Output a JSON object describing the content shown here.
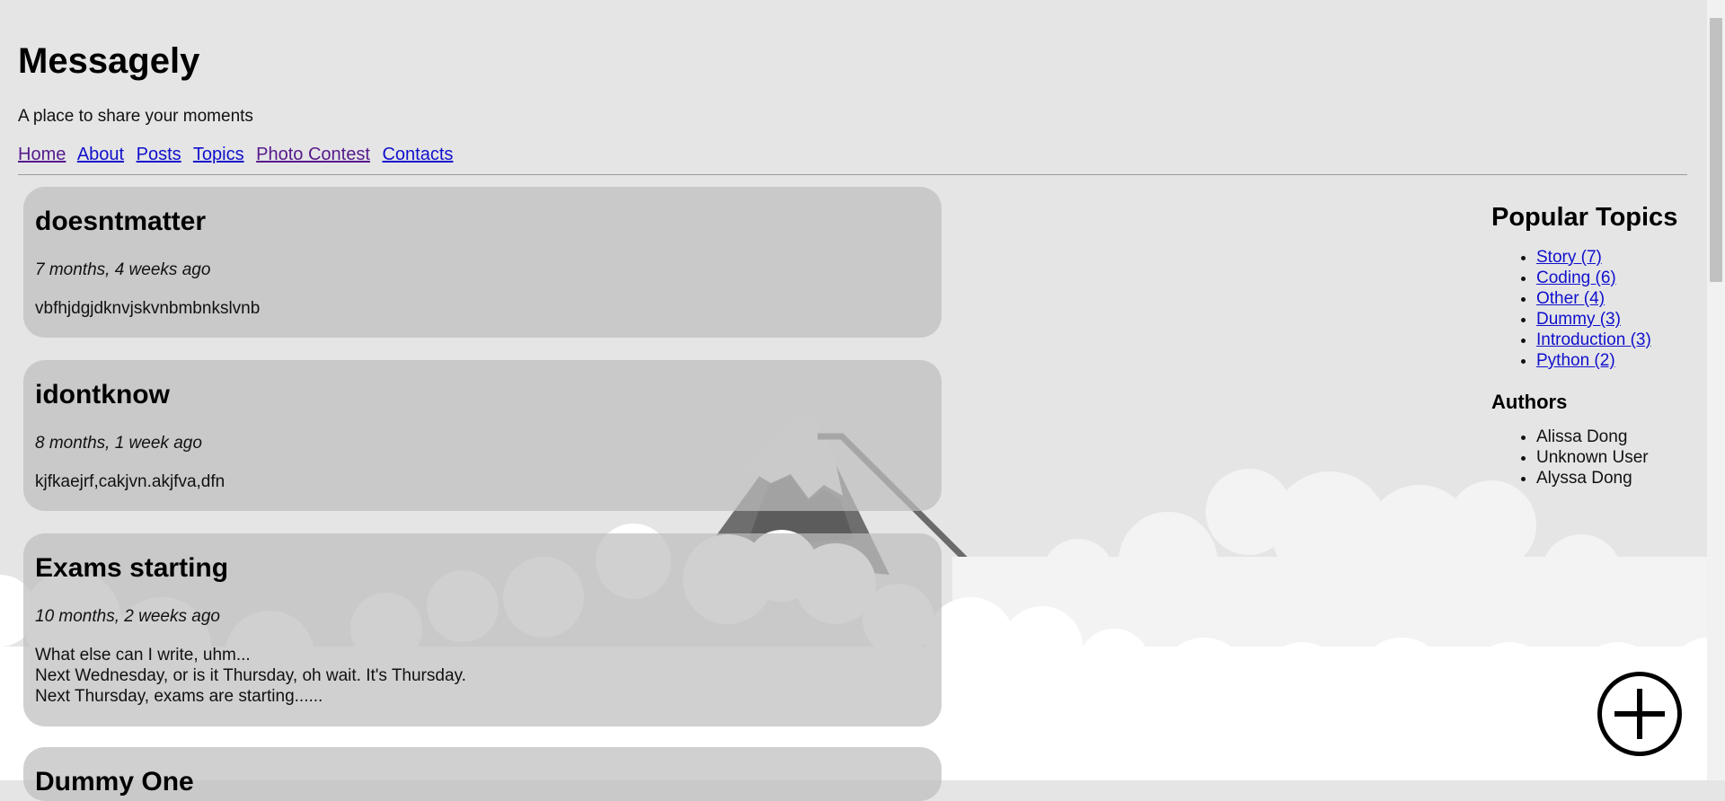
{
  "site": {
    "title": "Messagely",
    "tagline": "A place to share your moments"
  },
  "nav": {
    "home": "Home",
    "about": "About",
    "posts": "Posts",
    "topics": "Topics",
    "photo_contest": "Photo Contest",
    "contacts": "Contacts"
  },
  "posts": [
    {
      "title": "doesntmatter",
      "time": "7 months, 4 weeks ago",
      "body": [
        "vbfhjdgjdknvjskvnbmbnkslvnb"
      ]
    },
    {
      "title": "idontknow",
      "time": "8 months, 1 week ago",
      "body": [
        "kjfkaejrf,cakjvn.akjfva,dfn"
      ]
    },
    {
      "title": "Exams starting",
      "time": "10 months, 2 weeks ago",
      "body": [
        "What else can I write, uhm...",
        "Next Wednesday, or is it Thursday, oh wait. It's Thursday.",
        "Next Thursday, exams are starting......"
      ]
    },
    {
      "title": "Dummy One"
    }
  ],
  "sidebar": {
    "popular_heading": "Popular Topics",
    "topics": [
      "Story (7)",
      "Coding (6)",
      "Other (4)",
      "Dummy (3)",
      "Introduction (3)",
      "Python (2)"
    ],
    "authors_heading": "Authors",
    "authors": [
      "Alissa Dong",
      "Unknown User",
      "Alyssa Dong"
    ]
  },
  "icons": {
    "fab": "plus-circle-icon",
    "background": "mountain-clouds-illustration"
  },
  "colors": {
    "background": "#e5e5e6",
    "link": "#1010cc",
    "visited_link": "#551a8b"
  }
}
